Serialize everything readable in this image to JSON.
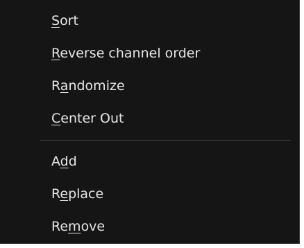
{
  "menu": {
    "items": [
      {
        "pre": "",
        "accel": "S",
        "post": "ort"
      },
      {
        "pre": "",
        "accel": "R",
        "post": "everse channel order"
      },
      {
        "pre": "R",
        "accel": "a",
        "post": "ndomize"
      },
      {
        "pre": "",
        "accel": "C",
        "post": "enter Out"
      }
    ],
    "items2": [
      {
        "pre": "A",
        "accel": "d",
        "post": "d"
      },
      {
        "pre": "R",
        "accel": "e",
        "post": "place"
      },
      {
        "pre": "Re",
        "accel": "m",
        "post": "ove"
      }
    ]
  }
}
